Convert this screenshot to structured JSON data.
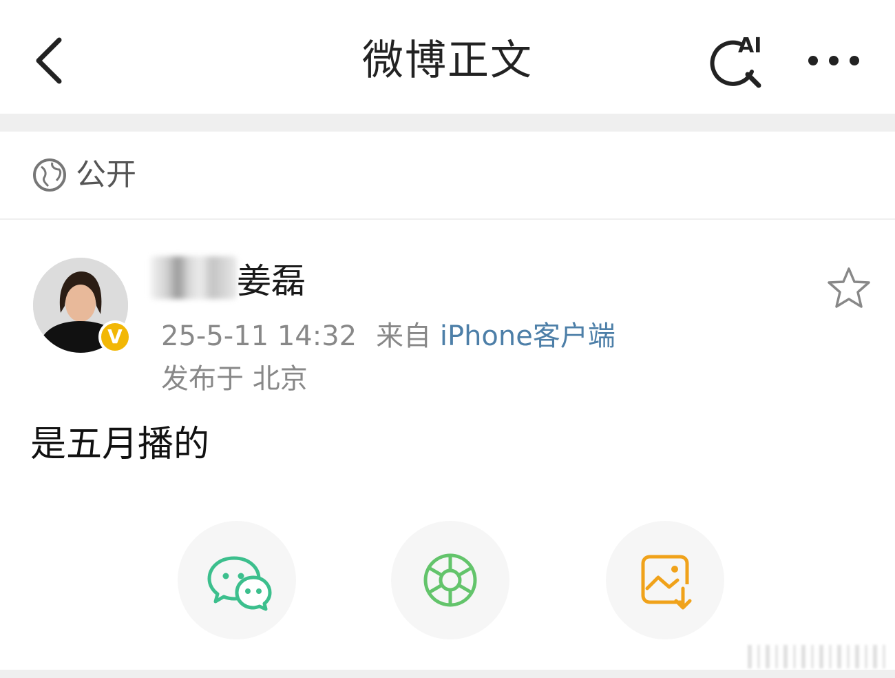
{
  "nav": {
    "title": "微博正文",
    "ai_badge": "AI",
    "icons": [
      "back-arrow-icon",
      "ai-search-icon",
      "more-dots-icon"
    ]
  },
  "visibility": {
    "label": "公开",
    "icon": "globe-icon"
  },
  "post": {
    "author_name": "姜磊",
    "verified_badge": "V",
    "timestamp": "25-5-11 14:32",
    "source_prefix": "来自",
    "source_client": "iPhone客户端",
    "location": "发布于 北京",
    "text": "是五月播的"
  },
  "share": [
    {
      "id": "wechat",
      "icon": "wechat-icon",
      "color": "#3cbf8d"
    },
    {
      "id": "moments",
      "icon": "moments-icon",
      "color": "#63c46b"
    },
    {
      "id": "save-image",
      "icon": "save-image-icon",
      "color": "#f0a21a"
    }
  ],
  "colors": {
    "link": "#4d7fa8",
    "badge": "#f2b705",
    "separator": "#efefef"
  }
}
